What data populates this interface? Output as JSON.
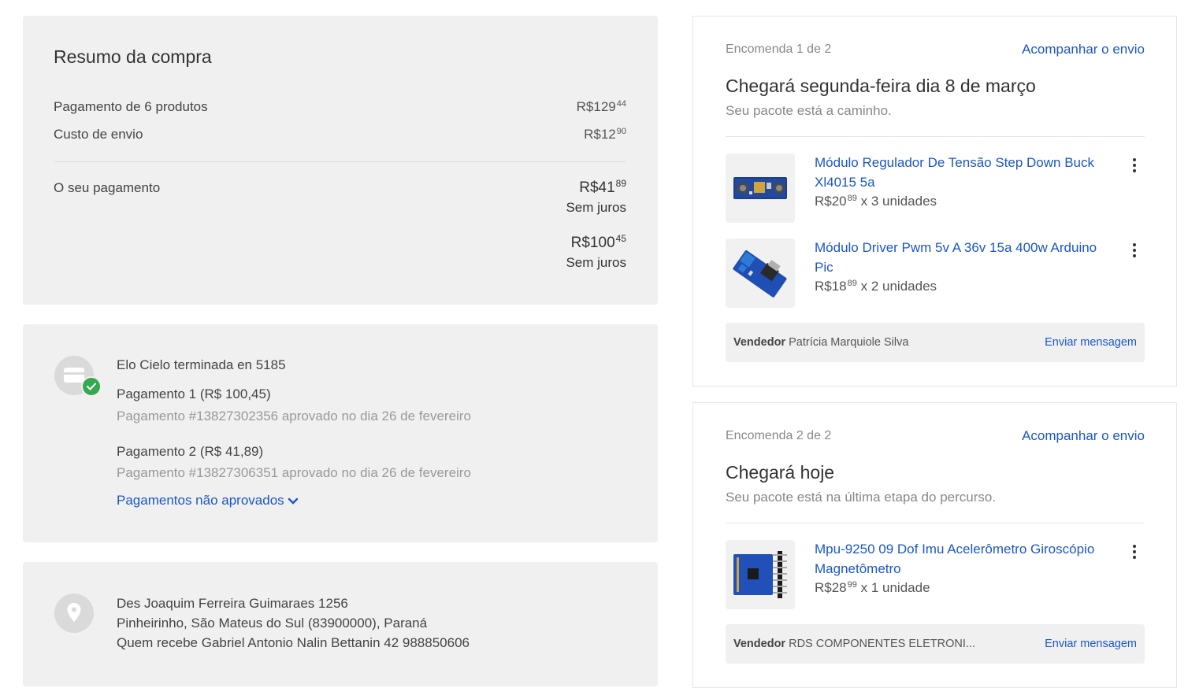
{
  "summary": {
    "title": "Resumo da compra",
    "products_label": "Pagamento de 6 produtos",
    "products_int": "R$129",
    "products_cents": "44",
    "shipping_label": "Custo de envio",
    "shipping_int": "R$12",
    "shipping_cents": "90",
    "your_payment_label": "O seu pagamento",
    "pay1_int": "R$41",
    "pay1_cents": "89",
    "pay1_terms": "Sem juros",
    "pay2_int": "R$100",
    "pay2_cents": "45",
    "pay2_terms": "Sem juros"
  },
  "payment": {
    "card_name": "Elo Cielo terminada en 5185",
    "p1_title": "Pagamento 1 (R$ 100,45)",
    "p1_detail": "Pagamento #13827302356 aprovado no dia 26 de fevereiro",
    "p2_title": "Pagamento 2 (R$ 41,89)",
    "p2_detail": "Pagamento #13827306351 aprovado no dia 26 de fevereiro",
    "not_approved_link": "Pagamentos não aprovados",
    "icons": {
      "card": "credit-card-icon",
      "check": "check-icon",
      "chevron": "chevron-down-icon"
    }
  },
  "address": {
    "line1": "Des Joaquim Ferreira Guimaraes 1256",
    "line2": "Pinheirinho, São Mateus do Sul (83900000), Paraná",
    "line3": "Quem recebe Gabriel Antonio Nalin Bettanin 42 988850606",
    "icon": "location-pin-icon"
  },
  "orders": [
    {
      "count": "Encomenda 1 de 2",
      "track_label": "Acompanhar o envio",
      "title": "Chegará segunda-feira dia 8 de março",
      "status": "Seu pacote está a caminho.",
      "items": [
        {
          "title": "Módulo Regulador De Tensão Step Down Buck Xl4015 5a",
          "price_int": "R$20",
          "price_cents": "89",
          "qty": " x 3 unidades"
        },
        {
          "title": "Módulo Driver Pwm 5v A 36v 15a 400w Arduino Pic",
          "price_int": "R$18",
          "price_cents": "89",
          "qty": " x 2 unidades"
        }
      ],
      "seller_label": "Vendedor",
      "seller_name": " Patrícia Marquiole Silva",
      "message_label": "Enviar mensagem"
    },
    {
      "count": "Encomenda 2 de 2",
      "track_label": "Acompanhar o envio",
      "title": "Chegará hoje",
      "status": "Seu pacote está na última etapa do percurso.",
      "items": [
        {
          "title": "Mpu-9250 09 Dof Imu Acelerômetro Giroscópio Magnetômetro",
          "price_int": "R$28",
          "price_cents": "99",
          "qty": " x 1 unidade"
        }
      ],
      "seller_label": "Vendedor",
      "seller_name": " RDS COMPONENTES ELETRONI...",
      "message_label": "Enviar mensagem"
    }
  ],
  "colors": {
    "link": "#1a57c9",
    "panel": "#f0f0f0",
    "success": "#34a853"
  }
}
